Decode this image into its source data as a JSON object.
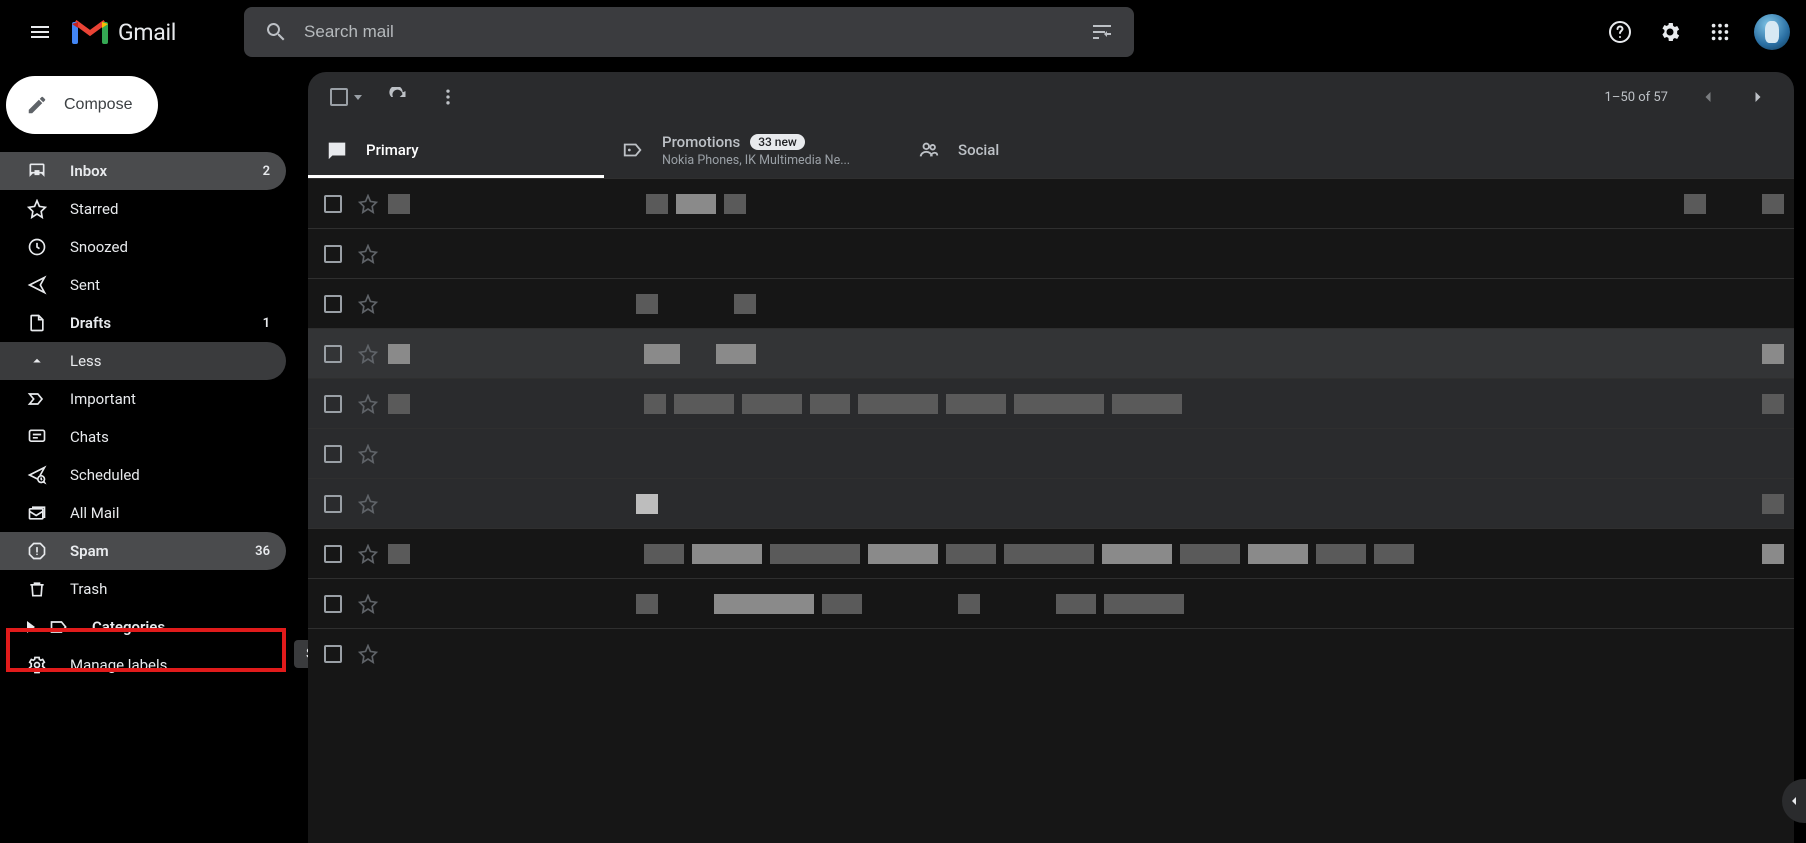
{
  "app": {
    "name": "Gmail"
  },
  "search": {
    "placeholder": "Search mail"
  },
  "compose": {
    "label": "Compose"
  },
  "sidebar": {
    "items": [
      {
        "id": "inbox",
        "label": "Inbox",
        "count": "2",
        "bold": true,
        "active": true
      },
      {
        "id": "starred",
        "label": "Starred"
      },
      {
        "id": "snoozed",
        "label": "Snoozed"
      },
      {
        "id": "sent",
        "label": "Sent"
      },
      {
        "id": "drafts",
        "label": "Drafts",
        "count": "1",
        "bold": true
      },
      {
        "id": "less",
        "label": "Less",
        "hovered": true
      },
      {
        "id": "important",
        "label": "Important"
      },
      {
        "id": "chats",
        "label": "Chats"
      },
      {
        "id": "scheduled",
        "label": "Scheduled"
      },
      {
        "id": "allmail",
        "label": "All Mail"
      },
      {
        "id": "spam",
        "label": "Spam",
        "count": "36",
        "bold": true,
        "hovered": true,
        "highlight": true
      },
      {
        "id": "trash",
        "label": "Trash"
      },
      {
        "id": "categories",
        "label": "Categories",
        "bold": true,
        "expandable": true
      },
      {
        "id": "manage",
        "label": "Manage labels"
      }
    ]
  },
  "tooltip": {
    "spam": "Spam"
  },
  "toolbar": {
    "pagination": "1–50 of 57"
  },
  "tabs": [
    {
      "id": "primary",
      "label": "Primary",
      "active": true
    },
    {
      "id": "promotions",
      "label": "Promotions",
      "badge": "33 new",
      "sub": "Nokia Phones, IK Multimedia Ne..."
    },
    {
      "id": "social",
      "label": "Social"
    }
  ],
  "rows_count": 10,
  "annotation": {
    "highlight_target": "spam"
  }
}
